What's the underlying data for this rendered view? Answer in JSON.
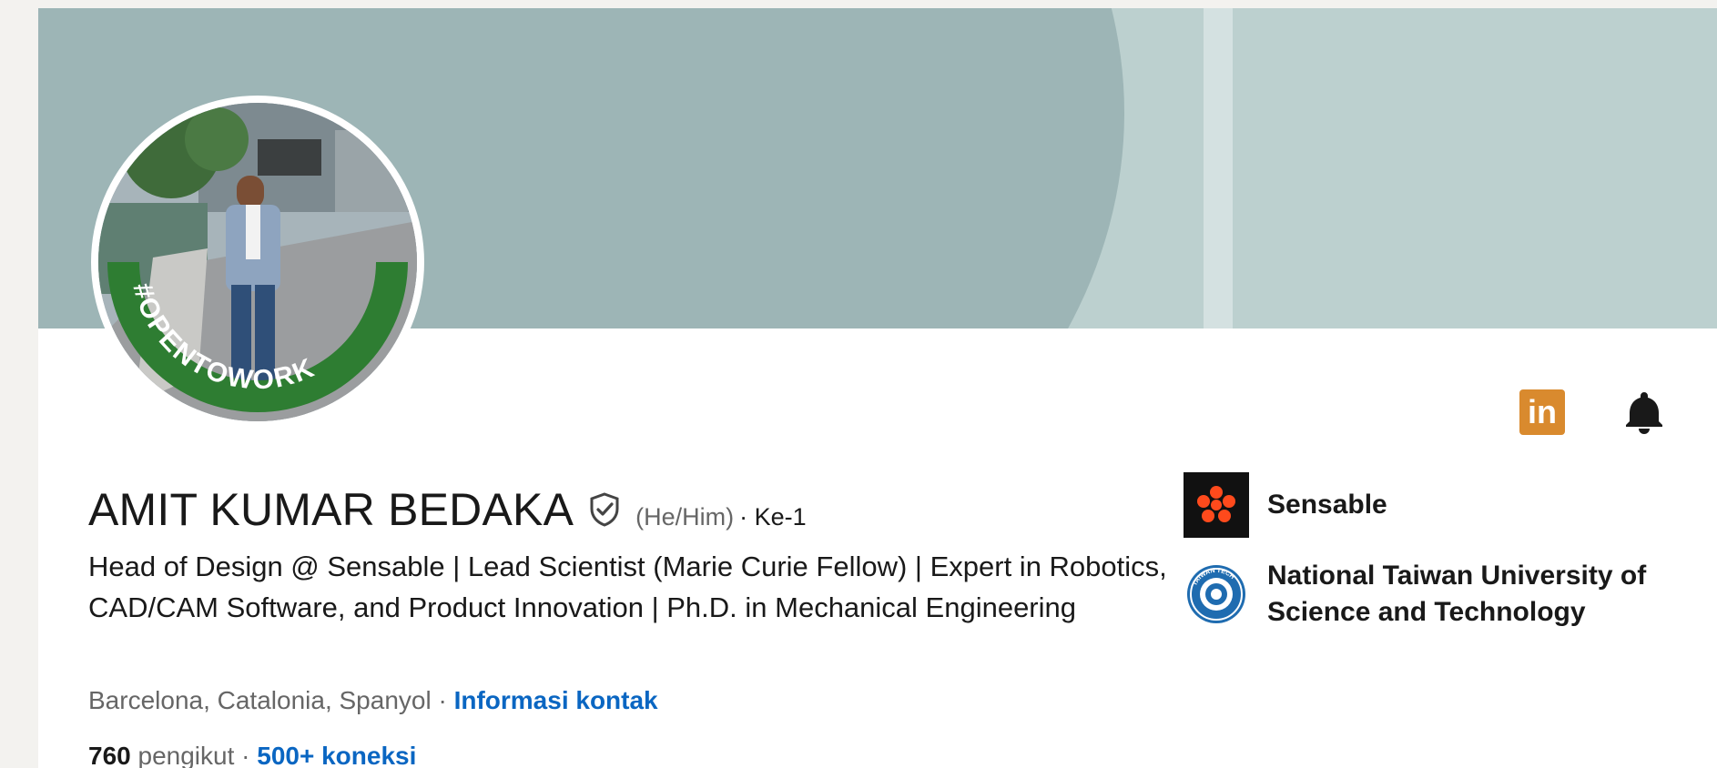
{
  "profile": {
    "name": "AMIT KUMAR BEDAKA",
    "pronouns": "(He/Him)",
    "degree": "· Ke-1",
    "headline": "Head of Design @ Sensable | Lead Scientist (Marie Curie Fellow) | Expert in Robotics, CAD/CAM Software, and Product Innovation | Ph.D. in Mechanical Engineering",
    "location": "Barcelona, Catalonia, Spanyol",
    "location_separator": " · ",
    "contact_link": "Informasi kontak",
    "followers_count": "760",
    "followers_label": " pengikut ",
    "stats_separator": " · ",
    "connections": "500+ koneksi",
    "avatar_frame_text": "#OPENTOWORK"
  },
  "actions": {
    "linkedin_icon": "linkedin-icon",
    "linkedin_text": "in",
    "bell_icon": "bell-icon"
  },
  "experience": [
    {
      "name": "Sensable",
      "logo": "sensable-logo"
    },
    {
      "name": "National Taiwan University of Science and Technology",
      "logo": "ntust-logo",
      "logo_text": "TAIWAN TECH"
    }
  ],
  "colors": {
    "link": "#0a66c2",
    "open_to_work": "#2e7d32",
    "banner_dark": "#9db5b6",
    "banner_light": "#bcd0cf",
    "linkedin_badge": "#d98a2e"
  }
}
